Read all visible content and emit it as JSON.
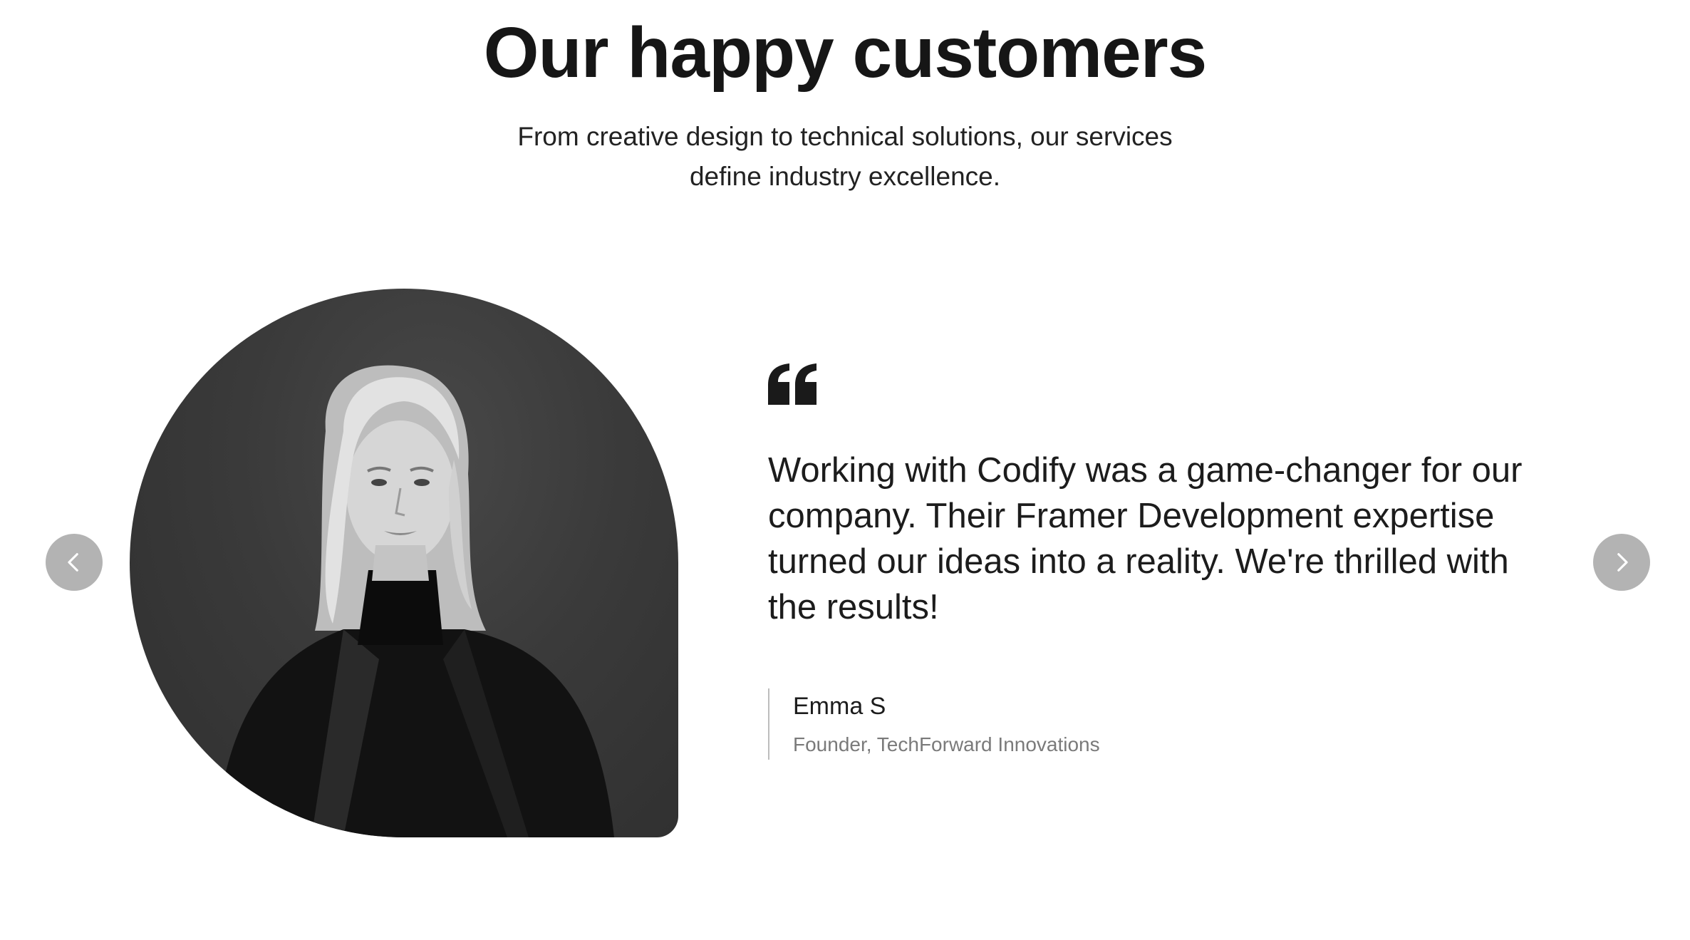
{
  "section": {
    "title": "Our happy customers",
    "subtitle": "From creative design to technical solutions, our services define industry excellence."
  },
  "carousel": {
    "prev_icon": "chevron-left-icon",
    "next_icon": "chevron-right-icon",
    "button_color": "#b3b3b3"
  },
  "testimonial": {
    "quote_icon": "quote-open-icon",
    "quote": "Working with Codify was a game-changer for our company. Their Framer Development expertise turned our ideas into a reality. We're thrilled with the results!",
    "author_name": "Emma S",
    "author_role": "Founder, TechForward Innovations"
  }
}
